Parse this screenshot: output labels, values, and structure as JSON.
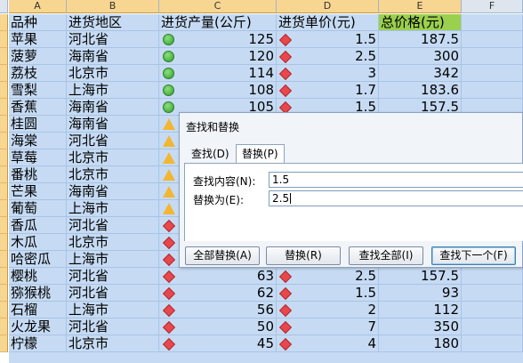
{
  "sheet": {
    "columns": [
      "A",
      "B",
      "C",
      "D",
      "E",
      "F"
    ],
    "headers": [
      "品种",
      "进货地区",
      "进货产量(公斤)",
      "进货单价(元)",
      "总价格(元)"
    ],
    "rows": [
      {
        "a": "苹果",
        "b": "河北省",
        "c": "125",
        "c_icon": "green",
        "d": "1.5",
        "d_icon": "red",
        "e": "187.5"
      },
      {
        "a": "菠萝",
        "b": "海南省",
        "c": "120",
        "c_icon": "green",
        "d": "2.5",
        "d_icon": "red",
        "e": "300"
      },
      {
        "a": "荔枝",
        "b": "北京市",
        "c": "114",
        "c_icon": "green",
        "d": "3",
        "d_icon": "red",
        "e": "342"
      },
      {
        "a": "雪梨",
        "b": "上海市",
        "c": "108",
        "c_icon": "green",
        "d": "1.7",
        "d_icon": "red",
        "e": "183.6"
      },
      {
        "a": "香蕉",
        "b": "海南省",
        "c": "105",
        "c_icon": "green",
        "d": "1.5",
        "d_icon": "red",
        "e": "157.5"
      },
      {
        "a": "桂圆",
        "b": "海南省",
        "c": "",
        "c_icon": "yellow",
        "d": "",
        "d_icon": "",
        "e": ""
      },
      {
        "a": "海棠",
        "b": "河北省",
        "c": "",
        "c_icon": "yellow",
        "d": "",
        "d_icon": "",
        "e": ""
      },
      {
        "a": "草莓",
        "b": "北京市",
        "c": "",
        "c_icon": "yellow",
        "d": "",
        "d_icon": "",
        "e": ""
      },
      {
        "a": "番桃",
        "b": "北京市",
        "c": "",
        "c_icon": "yellow",
        "d": "",
        "d_icon": "",
        "e": ""
      },
      {
        "a": "芒果",
        "b": "海南省",
        "c": "",
        "c_icon": "yellow",
        "d": "",
        "d_icon": "",
        "e": ""
      },
      {
        "a": "葡萄",
        "b": "上海市",
        "c": "",
        "c_icon": "yellow",
        "d": "",
        "d_icon": "",
        "e": ""
      },
      {
        "a": "香瓜",
        "b": "河北省",
        "c": "",
        "c_icon": "red",
        "d": "",
        "d_icon": "",
        "e": ""
      },
      {
        "a": "木瓜",
        "b": "北京市",
        "c": "",
        "c_icon": "red",
        "d": "",
        "d_icon": "",
        "e": ""
      },
      {
        "a": "哈密瓜",
        "b": "上海市",
        "c": "",
        "c_icon": "red",
        "d": "",
        "d_icon": "",
        "e": ""
      },
      {
        "a": "樱桃",
        "b": "河北省",
        "c": "63",
        "c_icon": "red",
        "d": "2.5",
        "d_icon": "red",
        "e": "157.5"
      },
      {
        "a": "猕猴桃",
        "b": "河北省",
        "c": "62",
        "c_icon": "red",
        "d": "1.5",
        "d_icon": "red",
        "e": "93"
      },
      {
        "a": "石榴",
        "b": "上海市",
        "c": "56",
        "c_icon": "red",
        "d": "2",
        "d_icon": "red",
        "e": "112"
      },
      {
        "a": "火龙果",
        "b": "河北省",
        "c": "50",
        "c_icon": "red",
        "d": "7",
        "d_icon": "red",
        "e": "350"
      },
      {
        "a": "柠檬",
        "b": "北京市",
        "c": "45",
        "c_icon": "red",
        "d": "4",
        "d_icon": "red",
        "e": "180"
      }
    ]
  },
  "dialog": {
    "title": "查找和替换",
    "tabs": [
      "查找(D)",
      "替换(P)"
    ],
    "find_label": "查找内容(N):",
    "find_value": "1.5",
    "replace_label": "替换为(E):",
    "replace_value": "2.5",
    "buttons": {
      "replace_all": "全部替换(A)",
      "replace": "替换(R)",
      "find_all": "查找全部(I)",
      "find_next": "查找下一个(F)"
    }
  }
}
